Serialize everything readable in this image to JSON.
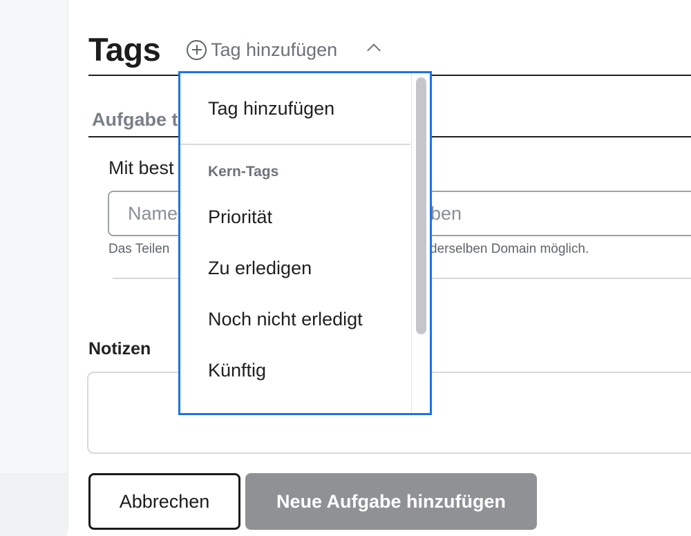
{
  "tags_section": {
    "title": "Tags",
    "add_tag_label": "Tag hinzufügen",
    "icons": {
      "add": "plus-circle-icon",
      "toggle": "chevron-up-icon"
    }
  },
  "share_section": {
    "heading": "Aufgabe t",
    "label": "Mit best",
    "input_placeholder_left": "Name",
    "input_placeholder_right": "ben",
    "hint_left": "Das Teilen",
    "hint_right": "derselben Domain möglich."
  },
  "notes": {
    "label": "Notizen",
    "value": ""
  },
  "footer": {
    "cancel_label": "Abbrechen",
    "submit_label": "Neue Aufgabe hinzufügen"
  },
  "dropdown": {
    "add_item": "Tag hinzufügen",
    "group_label": "Kern-Tags",
    "items": [
      "Priorität",
      "Zu erledigen",
      "Noch nicht erledigt",
      "Künftig"
    ]
  },
  "colors": {
    "focus_border": "#1a73e8",
    "disabled_button": "#8f9194"
  }
}
